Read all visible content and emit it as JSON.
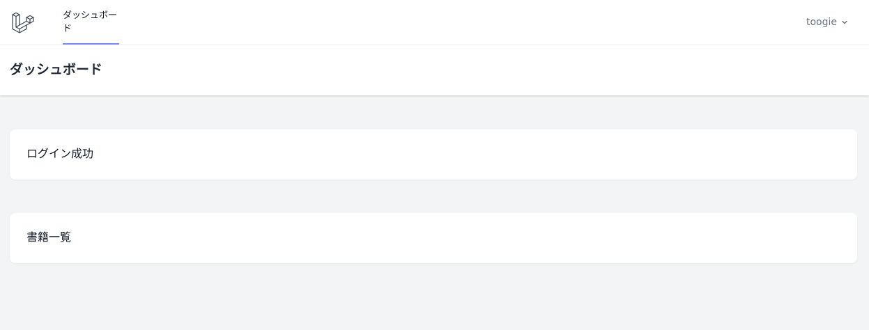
{
  "nav": {
    "logo_icon": "laravel-logo-icon",
    "dashboard_link": "ダッシュボード",
    "active_underline_color": "#818cf8",
    "user_name": "toogie",
    "user_menu_icon": "chevron-down-icon"
  },
  "header": {
    "title": "ダッシュボード"
  },
  "cards": [
    {
      "text": "ログイン成功"
    },
    {
      "text": "書籍一覧"
    }
  ],
  "colors": {
    "page_background": "#f3f4f6",
    "surface": "#ffffff",
    "text": "#111827",
    "muted_text": "#6b7280"
  }
}
